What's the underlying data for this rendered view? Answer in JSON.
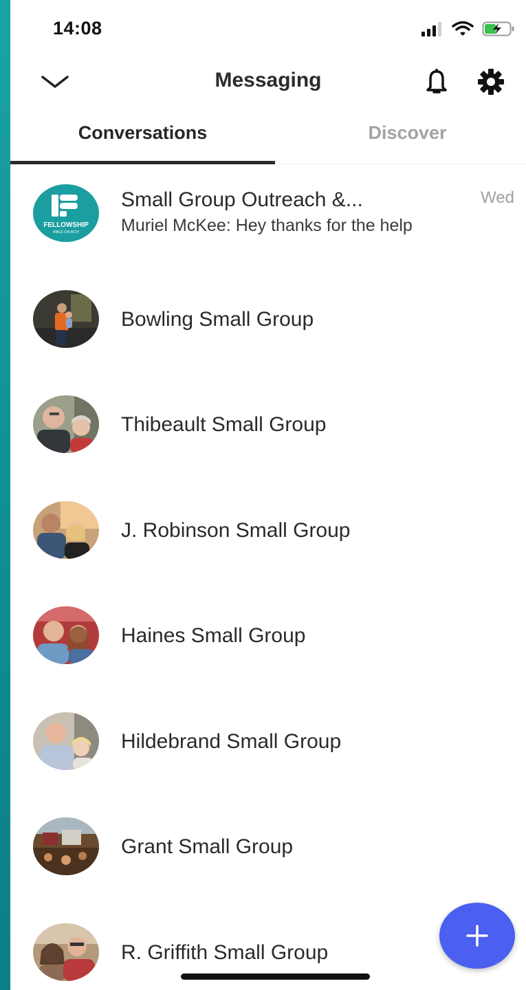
{
  "status_bar": {
    "time": "14:08"
  },
  "header": {
    "title": "Messaging"
  },
  "tabs": [
    {
      "label": "Conversations",
      "active": true
    },
    {
      "label": "Discover",
      "active": false
    }
  ],
  "conversations": [
    {
      "name": "Small Group Outreach &...",
      "preview": "Muriel McKee: Hey thanks for the help",
      "time": "Wed",
      "avatar_logo_text": "FELLOWSHIP",
      "avatar_logo_subtext": "BIBLE CHURCH"
    },
    {
      "name": "Bowling Small Group"
    },
    {
      "name": "Thibeault Small Group"
    },
    {
      "name": "J. Robinson Small Group"
    },
    {
      "name": "Haines Small Group"
    },
    {
      "name": "Hildebrand Small Group"
    },
    {
      "name": "Grant Small Group"
    },
    {
      "name": "R. Griffith Small Group"
    }
  ],
  "colors": {
    "accent": "#4b5ff0",
    "sidebar_strip": "#139a9f",
    "logo_bg": "#1b9ea0"
  },
  "icons": {
    "header_left": "chevron-down-icon",
    "header_bell": "bell-icon",
    "header_settings": "gear-icon",
    "fab": "plus-icon"
  }
}
